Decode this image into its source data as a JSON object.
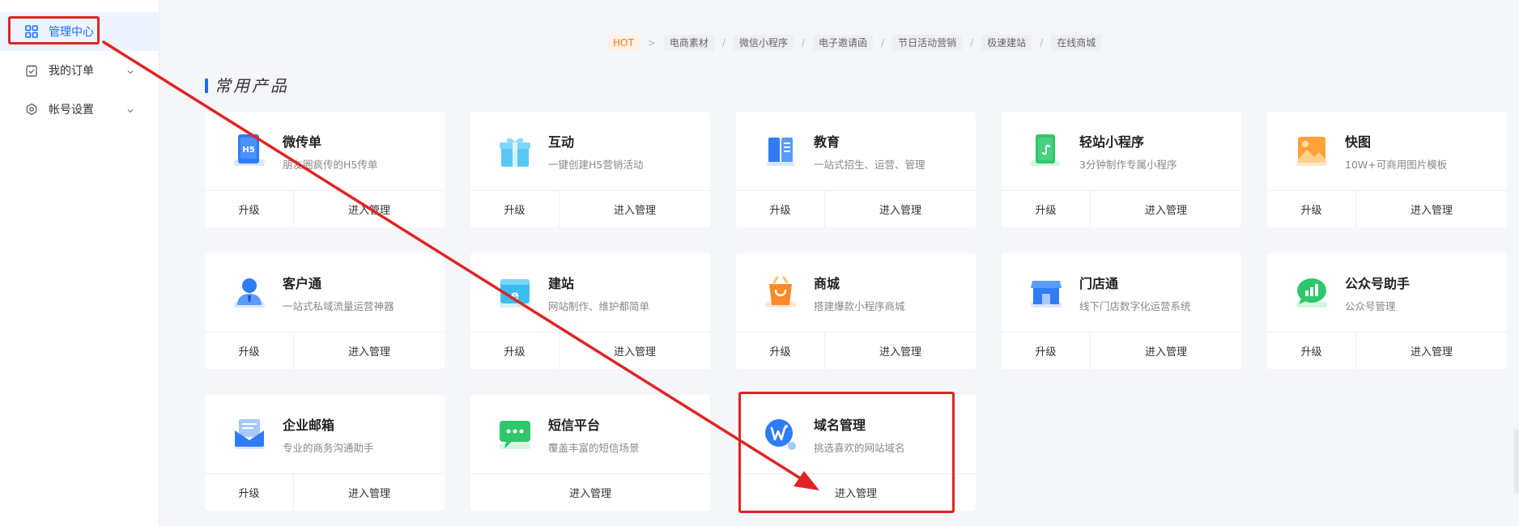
{
  "sidebar": {
    "items": [
      {
        "label": "管理中心",
        "icon": "grid-icon",
        "active": true
      },
      {
        "label": "我的订单",
        "icon": "order-icon",
        "active": false
      },
      {
        "label": "帐号设置",
        "icon": "settings-icon",
        "active": false
      }
    ]
  },
  "tags": [
    "HOT",
    "电商素材",
    "微信小程序",
    "电子邀请函",
    "节日活动营销",
    "极速建站",
    "在线商城"
  ],
  "section_title": "常用产品",
  "buttons": {
    "upgrade": "升级",
    "manage": "进入管理"
  },
  "products": [
    {
      "name": "微传单",
      "desc": "朋友圈疯传的H5传单",
      "icon": "h5-tablet-icon"
    },
    {
      "name": "互动",
      "desc": "一键创建H5营销活动",
      "icon": "gift-icon"
    },
    {
      "name": "教育",
      "desc": "一站式招生、运营、管理",
      "icon": "book-icon"
    },
    {
      "name": "轻站小程序",
      "desc": "3分钟制作专属小程序",
      "icon": "mini-program-icon"
    },
    {
      "name": "快图",
      "desc": "10W+可商用图片模板",
      "icon": "image-icon"
    },
    {
      "name": "客户通",
      "desc": "一站式私域流量运营神器",
      "icon": "customer-icon"
    },
    {
      "name": "建站",
      "desc": "网站制作、维护都简单",
      "icon": "website-icon"
    },
    {
      "name": "商城",
      "desc": "搭建爆款小程序商城",
      "icon": "shop-bag-icon"
    },
    {
      "name": "门店通",
      "desc": "线下门店数字化运营系统",
      "icon": "store-icon"
    },
    {
      "name": "公众号助手",
      "desc": "公众号管理",
      "icon": "wechat-chart-icon"
    },
    {
      "name": "企业邮箱",
      "desc": "专业的商务沟通助手",
      "icon": "mail-icon"
    },
    {
      "name": "短信平台",
      "desc": "覆盖丰富的短信场景",
      "icon": "sms-icon"
    },
    {
      "name": "域名管理",
      "desc": "挑选喜欢的网站域名",
      "icon": "domain-globe-icon"
    }
  ],
  "colors": {
    "accent": "#1a6cff",
    "highlight": "#e02424",
    "hot": "#ff7a1a"
  }
}
